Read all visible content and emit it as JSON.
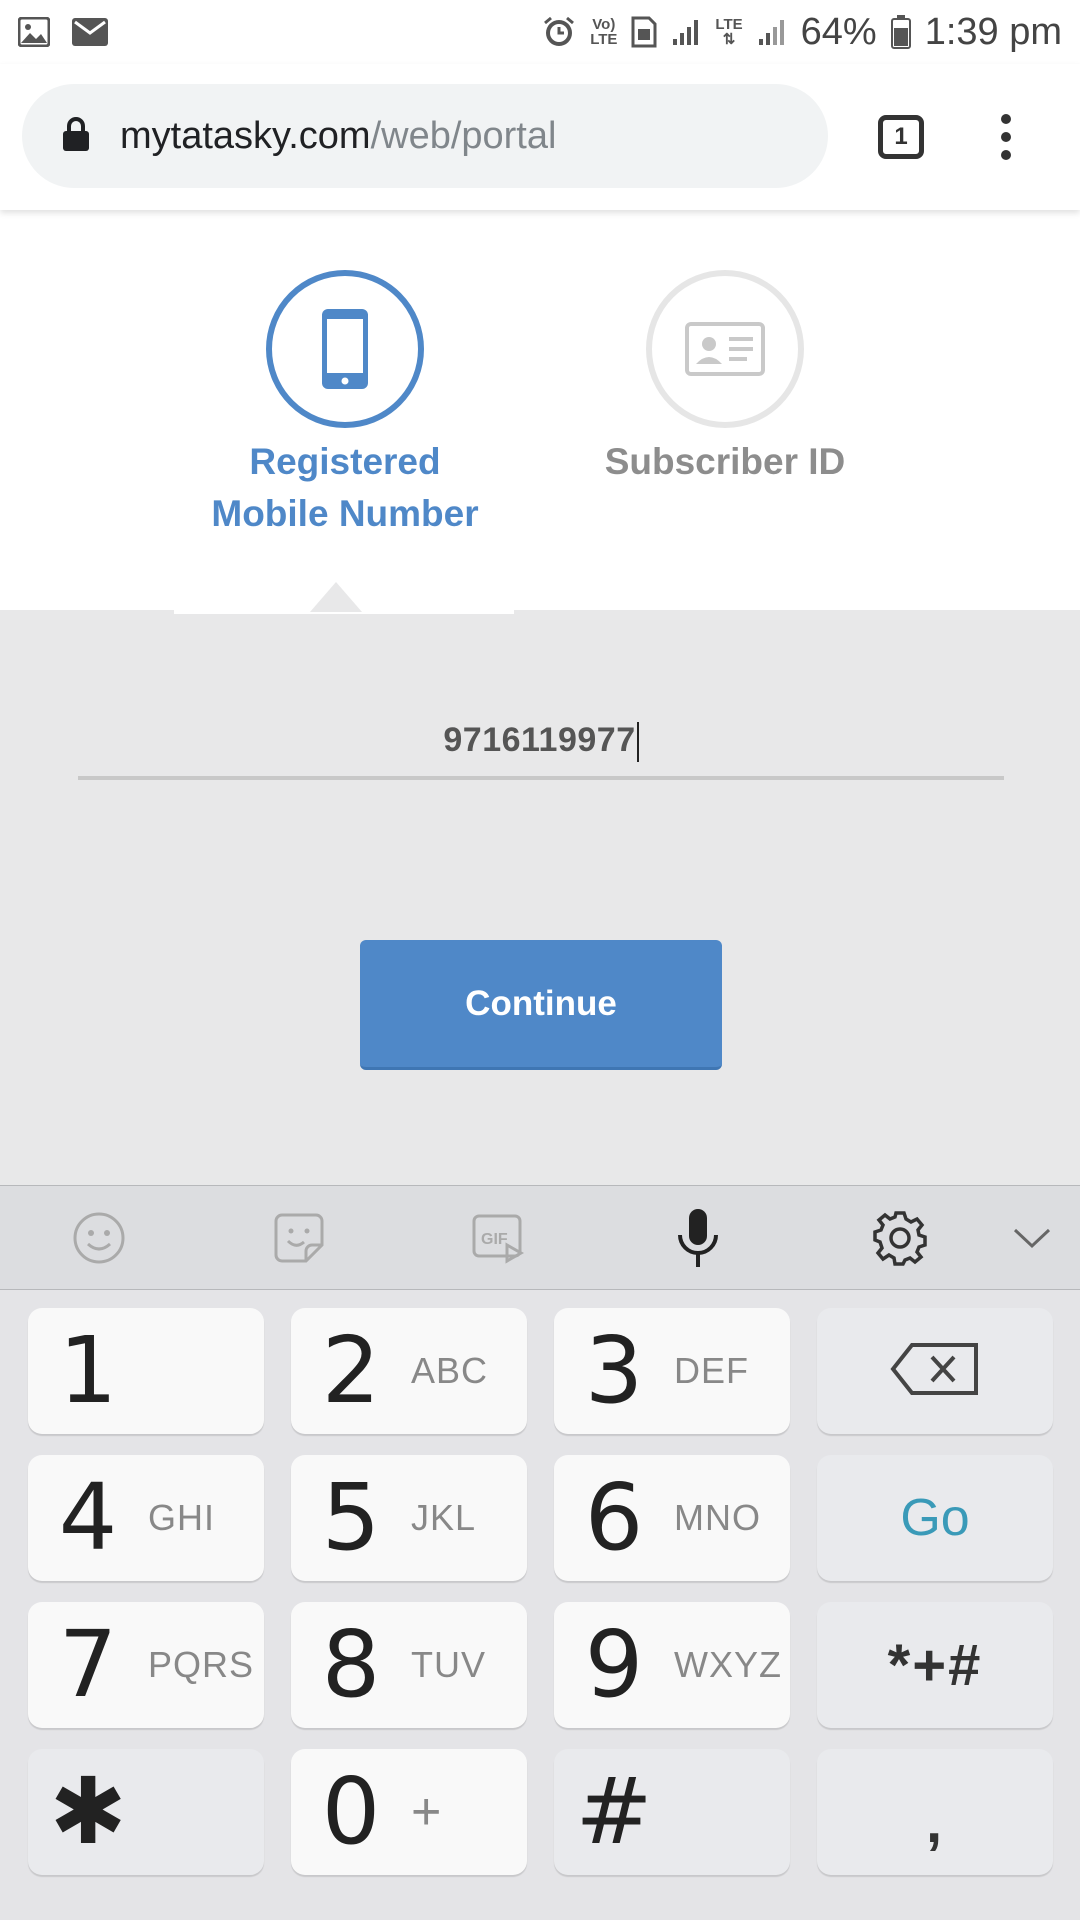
{
  "status_bar": {
    "battery": "64%",
    "time": "1:39 pm",
    "volte_line1": "Vo)",
    "volte_line2": "LTE",
    "lte_label": "LTE",
    "icons": [
      "image-icon",
      "mail-icon",
      "alarm-icon",
      "volte-icon",
      "sim-icon",
      "signal-icon",
      "lte-icon",
      "signal-icon",
      "battery-icon"
    ]
  },
  "browser": {
    "url_domain": "mytatasky.com",
    "url_path": "/web/portal",
    "tab_count": "1"
  },
  "login_options": {
    "mobile_label_line1": "Registered",
    "mobile_label_line2": "Mobile Number",
    "subscriber_label": "Subscriber ID",
    "active": "mobile"
  },
  "form": {
    "phone_value": "9716119977",
    "continue_label": "Continue"
  },
  "keyboard": {
    "toolbar": [
      "emoji-icon",
      "sticker-icon",
      "gif-icon",
      "microphone-icon",
      "settings-icon",
      "collapse-chevron-icon"
    ],
    "gif_label": "GIF",
    "keys": [
      {
        "num": "1",
        "letters": ""
      },
      {
        "num": "2",
        "letters": "ABC"
      },
      {
        "num": "3",
        "letters": "DEF"
      },
      {
        "num": "4",
        "letters": "GHI"
      },
      {
        "num": "5",
        "letters": "JKL"
      },
      {
        "num": "6",
        "letters": "MNO"
      },
      {
        "num": "7",
        "letters": "PQRS"
      },
      {
        "num": "8",
        "letters": "TUV"
      },
      {
        "num": "9",
        "letters": "WXYZ"
      },
      {
        "num": "0",
        "letters": "+"
      }
    ],
    "go_label": "Go",
    "symbols_label": "*+#",
    "hash_label": "#",
    "comma_label": ",",
    "star_label": "✱"
  },
  "colors": {
    "accent": "#4f88c8",
    "go": "#3a9ab8"
  }
}
